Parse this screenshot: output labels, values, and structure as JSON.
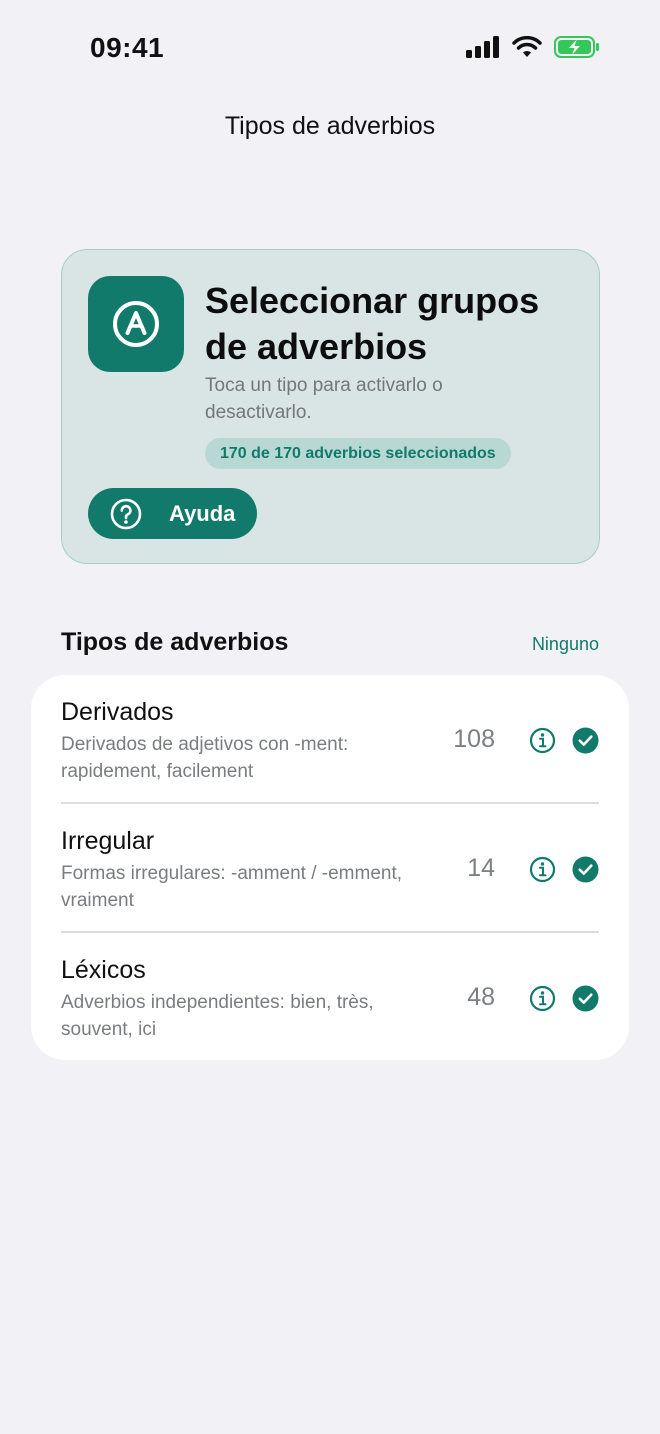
{
  "status_bar": {
    "time": "09:41",
    "icons": [
      "signal-bars-icon",
      "wifi-icon",
      "battery-charging-icon"
    ]
  },
  "nav": {
    "title": "Tipos de adverbios"
  },
  "hero": {
    "icon": "letter-a-circle-icon",
    "title": "Seleccionar grupos de adverbios",
    "subtitle": "Toca un tipo para activarlo o desactivarlo.",
    "badge": "170 de 170 adverbios seleccionados",
    "help_button": {
      "icon": "question-circle-icon",
      "label": "Ayuda"
    }
  },
  "section": {
    "title": "Tipos de adverbios",
    "none_link": "Ninguno"
  },
  "types": [
    {
      "title": "Derivados",
      "description": "Derivados de adjetivos con -ment: rapidement, facilement",
      "count": "108",
      "selected": true
    },
    {
      "title": "Irregular",
      "description": "Formas irregulares: -amment / -emment, vraiment",
      "count": "14",
      "selected": true
    },
    {
      "title": "Léxicos",
      "description": "Adverbios independientes: bien, très, souvent, ici",
      "count": "48",
      "selected": true
    }
  ],
  "colors": {
    "accent": "#127a6b",
    "hero_background": "#d9e5e5",
    "hero_border": "#a8cdc9",
    "badge_background": "#b8d8d4",
    "page_background": "#f2f2f6",
    "battery_green": "#34c759"
  }
}
